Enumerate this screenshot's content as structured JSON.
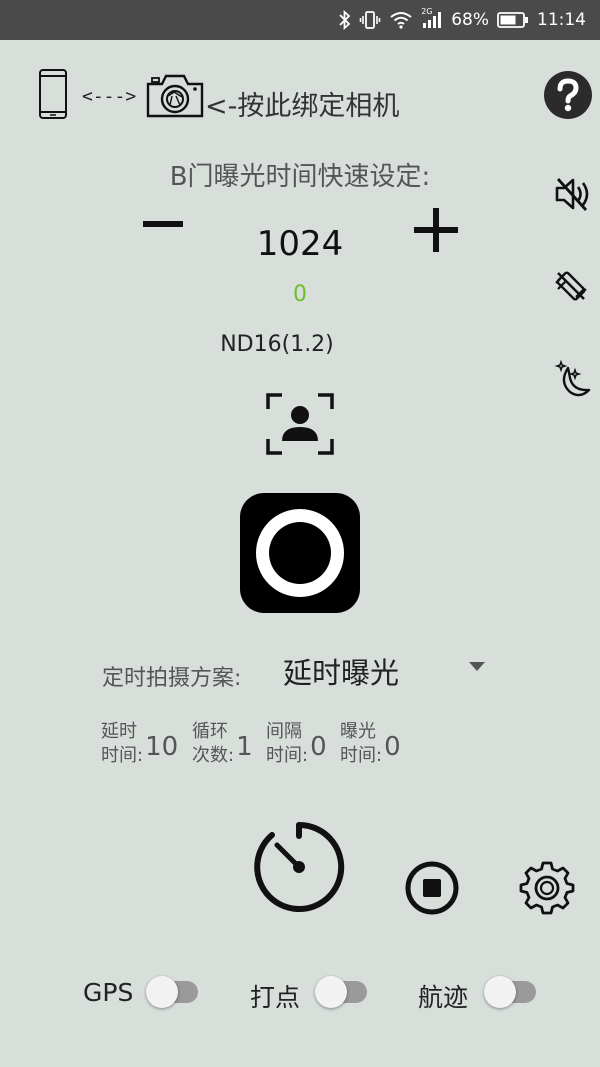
{
  "status_bar": {
    "battery_percent": "68%",
    "time": "11:14",
    "network_label": "2G"
  },
  "header": {
    "arrow_text": "<--->",
    "bind_camera_label": "<-按此绑定相机"
  },
  "bulb": {
    "title": "B门曝光时间快速设定:",
    "value": "1024",
    "ev_offset": "0",
    "nd_filter": "ND16(1.2)"
  },
  "timer_plan": {
    "label": "定时拍摄方案:",
    "selected": "延时曝光"
  },
  "params": [
    {
      "label_line1": "延时",
      "label_line2": "时间:",
      "value": "10"
    },
    {
      "label_line1": "循环",
      "label_line2": "次数:",
      "value": "1"
    },
    {
      "label_line1": "间隔",
      "label_line2": "时间:",
      "value": "0"
    },
    {
      "label_line1": "曝光",
      "label_line2": "时间:",
      "value": "0"
    }
  ],
  "toggles": [
    {
      "label": "GPS",
      "on": false
    },
    {
      "label": "打点",
      "on": false
    },
    {
      "label": "航迹",
      "on": false
    }
  ],
  "colors": {
    "background": "#d8dfdb",
    "status_bar": "#4a4a4a",
    "ev_offset": "#6dbe2a"
  },
  "icons": [
    "bluetooth-icon",
    "vibrate-icon",
    "wifi-icon",
    "signal-icon",
    "battery-icon",
    "phone-icon",
    "camera-icon",
    "help-icon",
    "sound-off-icon",
    "vibration-off-icon",
    "night-mode-icon",
    "face-focus-icon",
    "shutter-icon",
    "timer-icon",
    "stop-icon",
    "settings-icon"
  ]
}
